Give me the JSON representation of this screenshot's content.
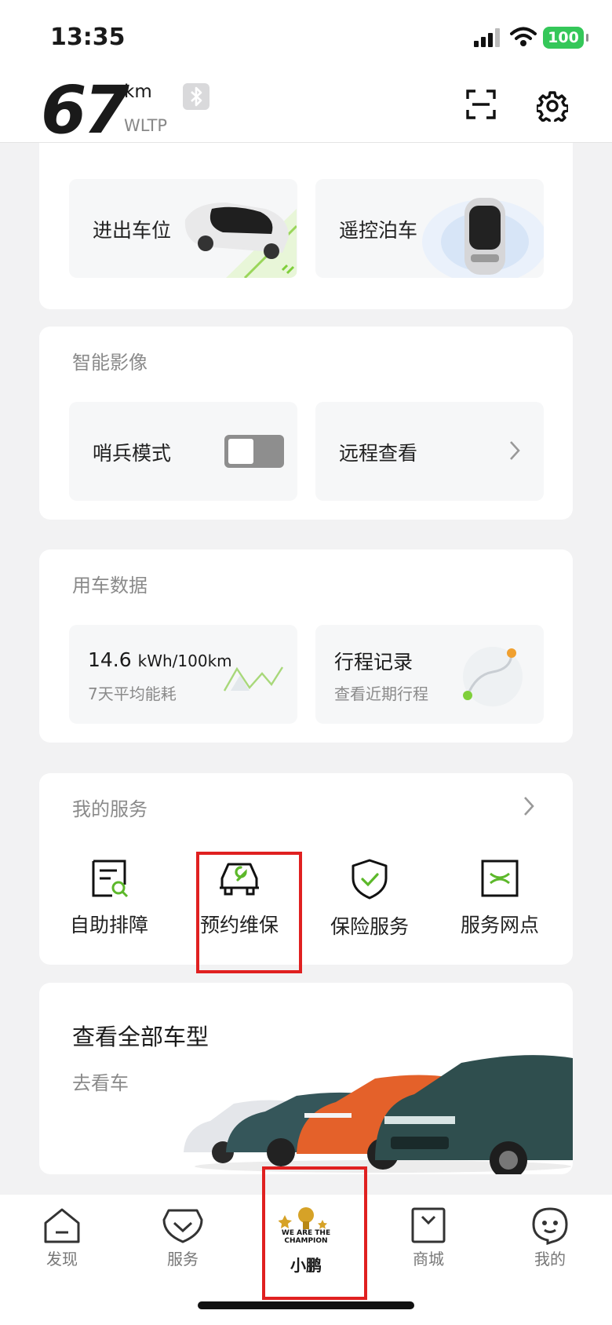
{
  "status_bar": {
    "time": "13:35",
    "battery": "100"
  },
  "header": {
    "range_value": "67",
    "range_unit": "km",
    "range_standard": "WLTP"
  },
  "parking": {
    "tiles": [
      {
        "label": "进出车位"
      },
      {
        "label": "遥控泊车"
      }
    ]
  },
  "imaging": {
    "title": "智能影像",
    "sentry_label": "哨兵模式",
    "sentry_on": false,
    "remote_view_label": "远程查看"
  },
  "vehicle_data": {
    "title": "用车数据",
    "consumption_value": "14.6",
    "consumption_unit": "kWh/100km",
    "consumption_caption": "7天平均能耗",
    "trip_title": "行程记录",
    "trip_caption": "查看近期行程"
  },
  "services": {
    "title": "我的服务",
    "items": [
      {
        "label": "自助排障",
        "icon": "self-diagnosis-icon"
      },
      {
        "label": "预约维保",
        "icon": "car-maintenance-icon"
      },
      {
        "label": "保险服务",
        "icon": "insurance-shield-icon"
      },
      {
        "label": "服务网点",
        "icon": "service-outlet-icon"
      }
    ]
  },
  "models": {
    "title": "查看全部车型",
    "link": "去看车"
  },
  "tabbar": {
    "tabs": [
      {
        "label": "发现",
        "icon": "home-icon"
      },
      {
        "label": "服务",
        "icon": "service-icon"
      },
      {
        "label": "小鹏",
        "icon": "champion-trophy-icon",
        "badge_text": "WE ARE THE CHAMPION"
      },
      {
        "label": "商城",
        "icon": "shop-icon"
      },
      {
        "label": "我的",
        "icon": "profile-icon"
      }
    ]
  },
  "colors": {
    "accent_green": "#7fcf3a",
    "highlight_red": "#e02020",
    "battery_green": "#34c759"
  }
}
